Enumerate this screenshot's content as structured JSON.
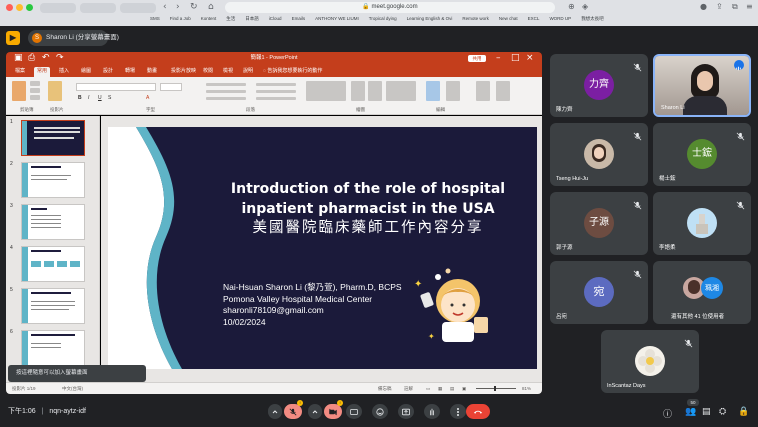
{
  "browser": {
    "tabs": [
      "",
      "",
      "",
      "",
      "",
      "",
      "",
      "",
      ""
    ],
    "url": "meet.google.com",
    "bookmarks": [
      "SMS",
      "Find a Job",
      "Kontent",
      "生活",
      "日本語",
      "iCloud",
      "Emails",
      "ANTHONY WE LIUMI",
      "Tropical dying",
      "Learning English & Ovi",
      "Remote work",
      "New chat",
      "EXCL",
      "WORD UP",
      "我想太長吧"
    ]
  },
  "meet": {
    "presenter_label": "Sharon Li (分享螢幕畫面)",
    "presenter_initial": "S",
    "time": "下午1:06",
    "separator": "|",
    "meeting_code": "nqn-aytz-idf",
    "participant_count": "50",
    "toast": "按這裡隨意可以加入螢幕畫面"
  },
  "ppt": {
    "window_title": "簡報1 - PowerPoint",
    "share_label": "共用",
    "tabs": [
      "檔案",
      "常用",
      "插入",
      "繪圖",
      "設計",
      "轉場",
      "動畫",
      "投影片放映",
      "校閱",
      "檢視",
      "說明"
    ],
    "search": "告訴我您想要執行的動作",
    "ribbon_groups": [
      "剪貼簿",
      "投影片",
      "字型",
      "段落",
      "繪圖",
      "編輯"
    ],
    "status_left": "投影片 1/19",
    "status_lang": "中文(台灣)",
    "status_notes": "備忘稿",
    "status_comments": "註解",
    "zoom": "81%"
  },
  "slide": {
    "title": "Introduction of the role of hospital\ninpatient pharmacist in the USA",
    "subtitle": "美國醫院臨床藥師工作內容分享",
    "info": [
      "Nai-Hsuan Sharon Li (黎乃萱), Pharm.D, BCPS",
      "Pomona Valley Hospital Medical Center",
      "sharonli78109@gmail.com",
      "10/02/2024"
    ]
  },
  "thumbnails": [
    {
      "num": "1",
      "title": "Introduction of the role of hospital inpatient pharmacist in the USA"
    },
    {
      "num": "2",
      "title": "BACKGROUND"
    },
    {
      "num": "3",
      "title": "OUTLINE"
    },
    {
      "num": "4",
      "title": "MY PROFESSIONAL JOURNEY"
    },
    {
      "num": "5",
      "title": "ROLES & DUTIES OF PHARMACIST"
    },
    {
      "num": "6",
      "title": "A DAY OF A CLINICAL PHARMACIST"
    }
  ],
  "participants": [
    {
      "name": "陳力齊",
      "avatar": "力齊",
      "color": "#7b1fa2"
    },
    {
      "name": "Sharon Li",
      "avatar": "",
      "color": ""
    },
    {
      "name": "Tseng Hui-Ju",
      "avatar": "",
      "color": ""
    },
    {
      "name": "楊士鋐",
      "avatar": "士鋐",
      "color": "#558b2f"
    },
    {
      "name": "郭子源",
      "avatar": "子源",
      "color": "#6d4c41"
    },
    {
      "name": "李語柔",
      "avatar": "",
      "color": ""
    },
    {
      "name": "呂宛",
      "avatar": "宛",
      "color": "#5c6bc0"
    },
    {
      "name": "還有其他 41 位使用者",
      "avatar": "",
      "color": ""
    },
    {
      "name": "InScantaz Days",
      "avatar": "",
      "color": ""
    }
  ],
  "extra_avatar": "珮湘",
  "colors": {
    "ppt_red": "#c43e1c",
    "slide_bg": "#1b1a3a",
    "wave": "#5fb4c7",
    "end_call": "#ea4335",
    "meet_bg": "#202124"
  }
}
